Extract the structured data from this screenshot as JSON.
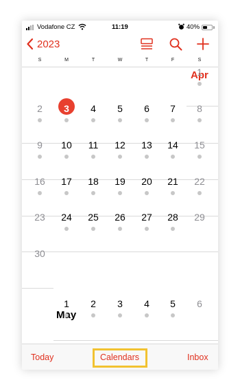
{
  "status_bar": {
    "carrier": "Vodafone CZ",
    "time": "11:19",
    "battery_percent": "40%",
    "battery_level": 0.4,
    "icons": [
      "signal-icon",
      "wifi-icon",
      "alarm-icon",
      "battery-icon"
    ]
  },
  "nav": {
    "back_label": "2023",
    "icons": [
      "list-view-icon",
      "search-icon",
      "add-icon"
    ]
  },
  "weekdays": [
    "S",
    "M",
    "T",
    "W",
    "T",
    "F",
    "S"
  ],
  "april": {
    "label": "Apr",
    "rows": [
      [
        "",
        "",
        "",
        "",
        "",
        "",
        "1"
      ],
      [
        "2",
        "3",
        "4",
        "5",
        "6",
        "7",
        "8"
      ],
      [
        "9",
        "10",
        "11",
        "12",
        "13",
        "14",
        "15"
      ],
      [
        "16",
        "17",
        "18",
        "19",
        "20",
        "21",
        "22"
      ],
      [
        "23",
        "24",
        "25",
        "26",
        "27",
        "28",
        "29"
      ],
      [
        "30",
        "",
        "",
        "",
        "",
        "",
        ""
      ]
    ],
    "today": "3"
  },
  "may": {
    "label": "May",
    "rows": [
      [
        "",
        "1",
        "2",
        "3",
        "4",
        "5",
        "6"
      ]
    ]
  },
  "toolbar": {
    "today": "Today",
    "calendars": "Calendars",
    "inbox": "Inbox"
  },
  "colors": {
    "accent": "#e0301e",
    "today_circle": "#e8402f",
    "highlight": "#f2c230"
  }
}
